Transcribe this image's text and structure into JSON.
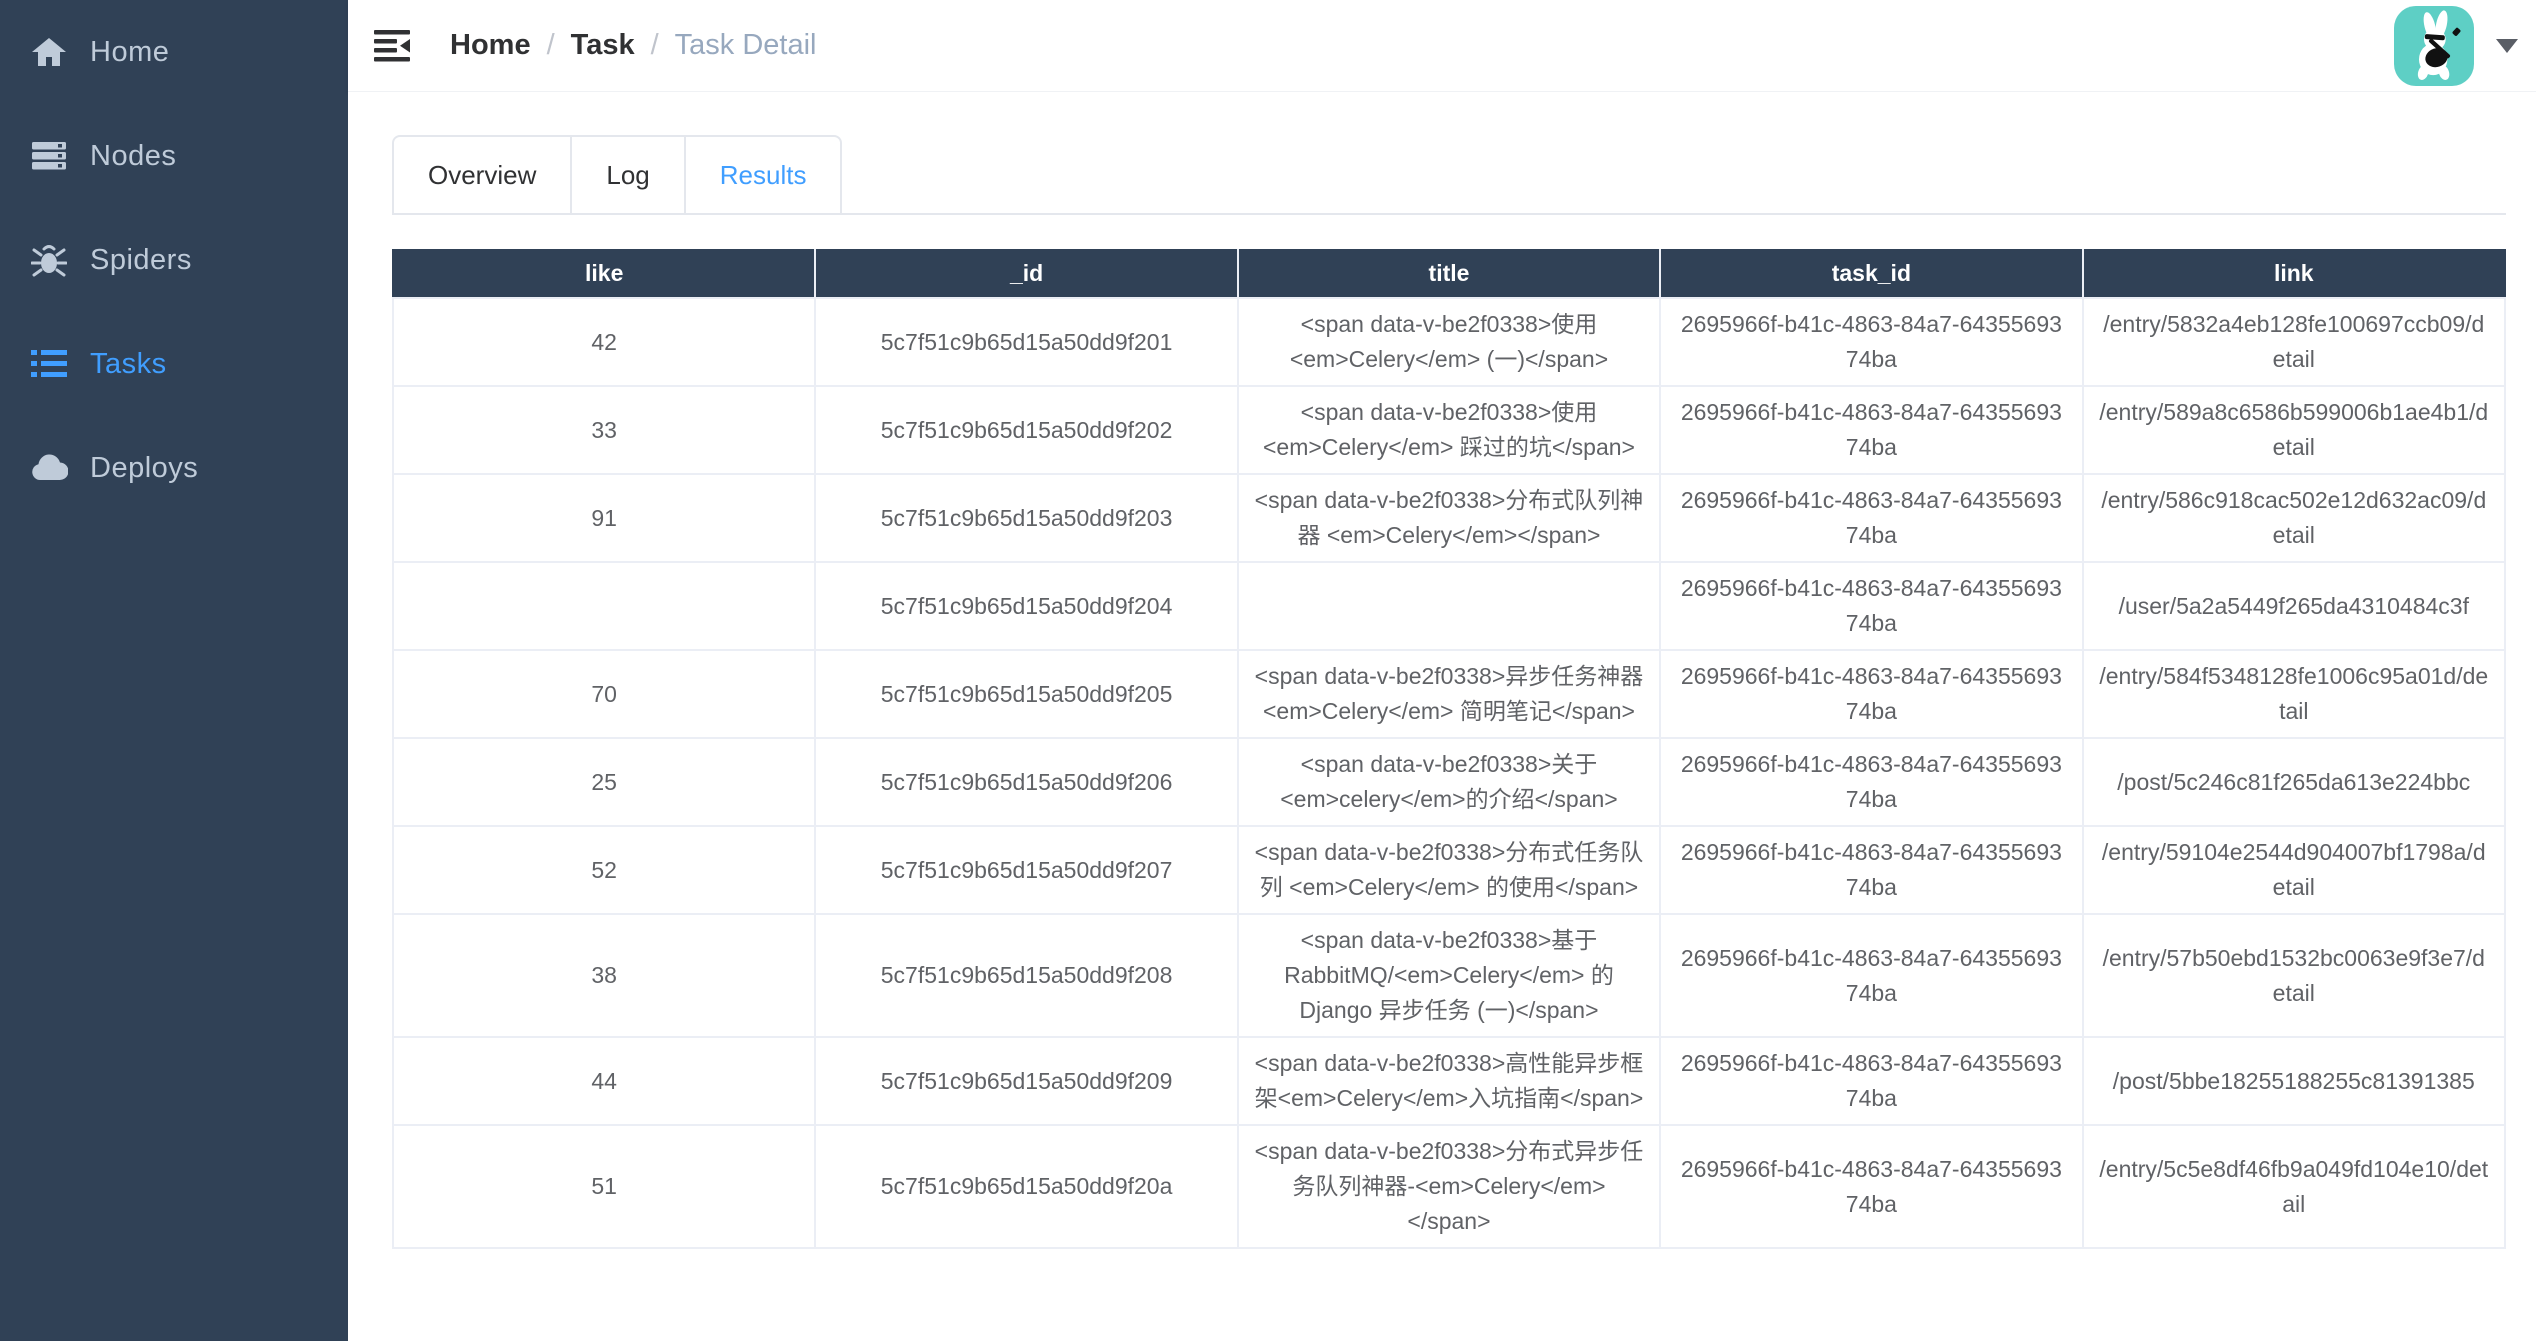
{
  "colors": {
    "sidebar_bg": "#304156",
    "sidebar_text": "#bfcbd9",
    "accent_blue": "#409EFF",
    "table_header_bg": "#304156",
    "table_border": "#EBEEF5",
    "avatar_bg": "#5ECFC5"
  },
  "sidebar": {
    "items": [
      {
        "label": "Home",
        "icon": "home-icon",
        "active": false
      },
      {
        "label": "Nodes",
        "icon": "nodes-icon",
        "active": false
      },
      {
        "label": "Spiders",
        "icon": "spider-icon",
        "active": false
      },
      {
        "label": "Tasks",
        "icon": "tasks-icon",
        "active": true
      },
      {
        "label": "Deploys",
        "icon": "deploys-icon",
        "active": false
      }
    ]
  },
  "navbar": {
    "hamburger_icon": "menu-fold-icon",
    "breadcrumb": {
      "items": [
        "Home",
        "Task",
        "Task Detail"
      ],
      "separator": "/"
    },
    "avatar_icon": "rabbit-guitar-logo",
    "caret_icon": "chevron-down-icon"
  },
  "tabs": [
    {
      "label": "Overview",
      "active": false
    },
    {
      "label": "Log",
      "active": false
    },
    {
      "label": "Results",
      "active": true
    }
  ],
  "table": {
    "columns": [
      "like",
      "_id",
      "title",
      "task_id",
      "link"
    ],
    "rows": [
      {
        "like": "42",
        "_id": "5c7f51c9b65d15a50dd9f201",
        "title": "<span data-v-be2f0338>使用 <em>Celery</em> (一)</span>",
        "task_id": "2695966f-b41c-4863-84a7-6435569374ba",
        "link": "/entry/5832a4eb128fe100697ccb09/detail"
      },
      {
        "like": "33",
        "_id": "5c7f51c9b65d15a50dd9f202",
        "title": "<span data-v-be2f0338>使用 <em>Celery</em> 踩过的坑</span>",
        "task_id": "2695966f-b41c-4863-84a7-6435569374ba",
        "link": "/entry/589a8c6586b599006b1ae4b1/detail"
      },
      {
        "like": "91",
        "_id": "5c7f51c9b65d15a50dd9f203",
        "title": "<span data-v-be2f0338>分布式队列神器 <em>Celery</em></span>",
        "task_id": "2695966f-b41c-4863-84a7-6435569374ba",
        "link": "/entry/586c918cac502e12d632ac09/detail"
      },
      {
        "like": "",
        "_id": "5c7f51c9b65d15a50dd9f204",
        "title": "",
        "task_id": "2695966f-b41c-4863-84a7-6435569374ba",
        "link": "/user/5a2a5449f265da4310484c3f"
      },
      {
        "like": "70",
        "_id": "5c7f51c9b65d15a50dd9f205",
        "title": "<span data-v-be2f0338>异步任务神器 <em>Celery</em> 简明笔记</span>",
        "task_id": "2695966f-b41c-4863-84a7-6435569374ba",
        "link": "/entry/584f5348128fe1006c95a01d/detail"
      },
      {
        "like": "25",
        "_id": "5c7f51c9b65d15a50dd9f206",
        "title": "<span data-v-be2f0338>关于 <em>celery</em>的介绍</span>",
        "task_id": "2695966f-b41c-4863-84a7-6435569374ba",
        "link": "/post/5c246c81f265da613e224bbc"
      },
      {
        "like": "52",
        "_id": "5c7f51c9b65d15a50dd9f207",
        "title": "<span data-v-be2f0338>分布式任务队列 <em>Celery</em> 的使用</span>",
        "task_id": "2695966f-b41c-4863-84a7-6435569374ba",
        "link": "/entry/59104e2544d904007bf1798a/detail"
      },
      {
        "like": "38",
        "_id": "5c7f51c9b65d15a50dd9f208",
        "title": "<span data-v-be2f0338>基于RabbitMQ/<em>Celery</em> 的 Django 异步任务 (一)</span>",
        "task_id": "2695966f-b41c-4863-84a7-6435569374ba",
        "link": "/entry/57b50ebd1532bc0063e9f3e7/detail"
      },
      {
        "like": "44",
        "_id": "5c7f51c9b65d15a50dd9f209",
        "title": "<span data-v-be2f0338>高性能异步框架<em>Celery</em>入坑指南</span>",
        "task_id": "2695966f-b41c-4863-84a7-6435569374ba",
        "link": "/post/5bbe18255188255c81391385"
      },
      {
        "like": "51",
        "_id": "5c7f51c9b65d15a50dd9f20a",
        "title": "<span data-v-be2f0338>分布式异步任务队列神器-<em>Celery</em></span>",
        "task_id": "2695966f-b41c-4863-84a7-6435569374ba",
        "link": "/entry/5c5e8df46fb9a049fd104e10/detail"
      }
    ]
  }
}
